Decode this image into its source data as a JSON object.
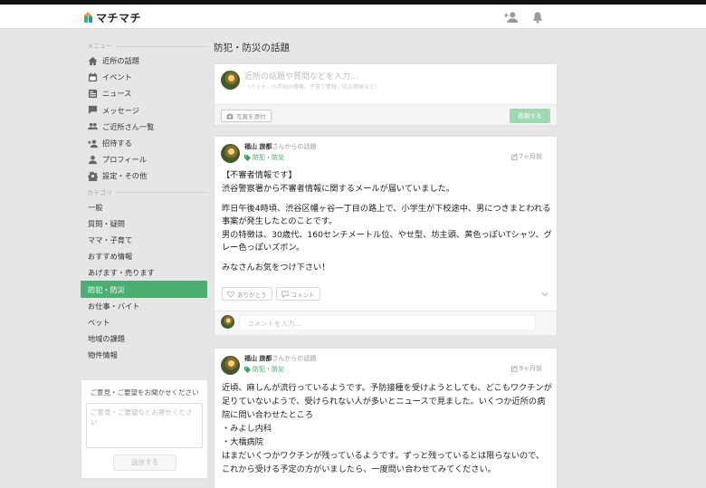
{
  "app": {
    "name": "マチマチ"
  },
  "header": {
    "icons": [
      "person-add-icon",
      "bell-icon"
    ]
  },
  "sidebar": {
    "menu_label": "メニュー",
    "menu_items": [
      {
        "label": "近所の話題",
        "icon": "home-icon"
      },
      {
        "label": "イベント",
        "icon": "calendar-icon"
      },
      {
        "label": "ニュース",
        "icon": "news-icon"
      },
      {
        "label": "メッセージ",
        "icon": "chat-icon"
      },
      {
        "label": "ご近所さん一覧",
        "icon": "people-icon"
      },
      {
        "label": "招待する",
        "icon": "person-add-icon"
      },
      {
        "label": "プロフィール",
        "icon": "person-icon"
      },
      {
        "label": "設定・その他",
        "icon": "gear-icon"
      }
    ],
    "category_label": "カテゴリ",
    "categories": [
      "一般",
      "質問・疑問",
      "ママ・子育て",
      "おすすめ情報",
      "あげます・売ります",
      "防犯・防災",
      "お仕事・バイト",
      "ペット",
      "地域の課題",
      "物件情報"
    ],
    "active_category": "防犯・防災",
    "feedback": {
      "title": "ご意見・ご要望をお聞かせください",
      "placeholder": "ご意見・ご要望などお寄せください",
      "button": "送信する"
    }
  },
  "main": {
    "title": "防犯・防災の話題",
    "composer": {
      "placeholder": "近所の話題や質問などを入力...",
      "subtext": "（ペット、小学校の情報、子育て情報、防災情報など）",
      "photo_button": "写真を添付",
      "post_button": "投稿する"
    },
    "posts": [
      {
        "author": "福山 旅都",
        "author_suffix": "さんからの話題",
        "tag": "防犯・防災",
        "time": "7ヶ月前",
        "paragraphs": [
          "【不審者情報です】\n渋谷警察署から不審者情報に関するメールが届いていました。",
          "昨日午後4時頃、渋谷区幡ヶ谷一丁目の路上で、小学生が下校途中、男につきまとわれる事案が発生したとのことです。\n男の特徴は、30歳代、160センチメートル位、やせ型、坊主頭、黄色っぽいTシャツ、グレー色っぽいズボン。",
          "みなさんお気をつけ下さい！"
        ],
        "like_label": "ありがとう",
        "comment_label": "コメント",
        "comment_placeholder": "コメントを入力..."
      },
      {
        "author": "福山 旅都",
        "author_suffix": "さんからの話題",
        "tag": "防犯・防災",
        "time": "9ヶ月前",
        "paragraphs": [
          "近頃、麻しんが流行っているようです。予防接種を受けようとしても、どこもワクチンが足りていないようで、受けられない人が多いとニュースで見ました。いくつか近所の病院に問い合わせたところ\n・みよし内科\n・大橋病院\nはまだいくつかワクチンが残っているようです。ずっと残っているとは限らないので、これから受ける予定の方がいましたら、一度問い合わせてみてください。"
        ]
      }
    ]
  },
  "colors": {
    "accent": "#4caf72",
    "tag": "#3aa15f",
    "post_button": "#9fd9b4"
  }
}
